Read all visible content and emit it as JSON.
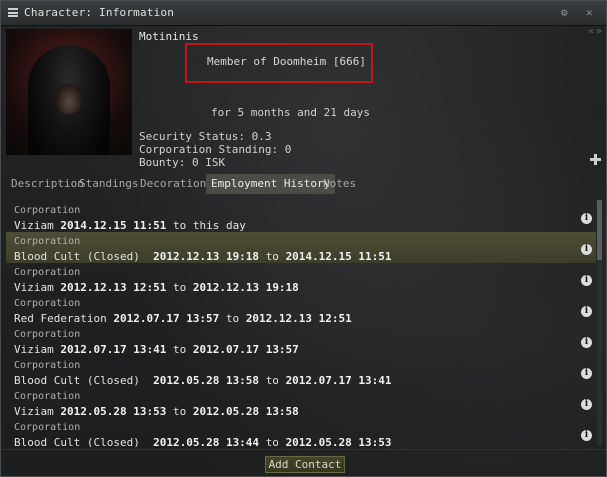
{
  "window": {
    "title": "Character: Information"
  },
  "character": {
    "name": "Motininis",
    "membership": "Member of Doomheim [666]",
    "duration": "for 5 months and 21 days",
    "security_status": "Security Status: 0.3",
    "corporation_standing": "Corporation Standing: 0",
    "bounty": "Bounty: 0 ISK"
  },
  "tabs": [
    "Description",
    "Standings",
    "Decorations",
    "Employment History",
    "Notes"
  ],
  "active_tab": "Employment History",
  "employment": [
    {
      "label": "Corporation",
      "corp": "Viziam",
      "from": "2014.12.15 11:51",
      "sep": "to",
      "to": "this day",
      "to_bold": false,
      "selected": false
    },
    {
      "label": "Corporation",
      "corp": "Blood Cult (Closed)",
      "from": "2012.12.13 19:18",
      "sep": "to",
      "to": "2014.12.15 11:51",
      "to_bold": true,
      "selected": true
    },
    {
      "label": "Corporation",
      "corp": "Viziam",
      "from": "2012.12.13 12:51",
      "sep": "to",
      "to": "2012.12.13 19:18",
      "to_bold": true,
      "selected": false
    },
    {
      "label": "Corporation",
      "corp": "Red Federation",
      "from": "2012.07.17 13:57",
      "sep": "to",
      "to": "2012.12.13 12:51",
      "to_bold": true,
      "selected": false
    },
    {
      "label": "Corporation",
      "corp": "Viziam",
      "from": "2012.07.17 13:41",
      "sep": "to",
      "to": "2012.07.17 13:57",
      "to_bold": true,
      "selected": false
    },
    {
      "label": "Corporation",
      "corp": "Blood Cult (Closed)",
      "from": "2012.05.28 13:58",
      "sep": "to",
      "to": "2012.07.17 13:41",
      "to_bold": true,
      "selected": false
    },
    {
      "label": "Corporation",
      "corp": "Viziam",
      "from": "2012.05.28 13:53",
      "sep": "to",
      "to": "2012.05.28 13:58",
      "to_bold": true,
      "selected": false
    },
    {
      "label": "Corporation",
      "corp": "Blood Cult (Closed)",
      "from": "2012.05.28 13:44",
      "sep": "to",
      "to": "2012.05.28 13:53",
      "to_bold": true,
      "selected": false
    }
  ],
  "buttons": {
    "add_contact": "Add Contact"
  },
  "icons": {
    "menu": "menu-icon",
    "settings": "gear-icon",
    "close": "close-icon",
    "collapse": "double-chevron-icon",
    "add": "plus-icon",
    "info": "info-icon"
  },
  "colors": {
    "highlight_box": "#c01818",
    "selected_row": "#4e4d35",
    "active_tab": "#4a4c46"
  }
}
